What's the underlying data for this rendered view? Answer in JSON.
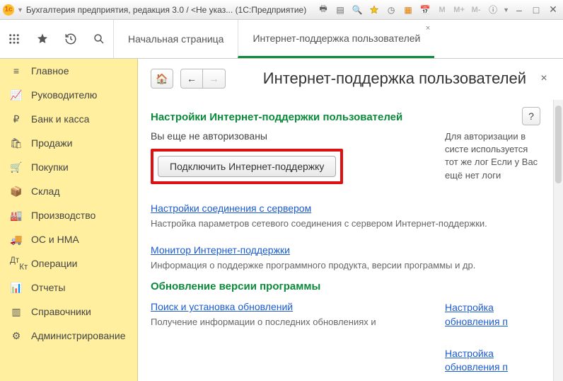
{
  "window": {
    "title": "Бухгалтерия предприятия, редакция 3.0 / <Не указ...  (1С:Предприятие)"
  },
  "toolbar": {
    "grid_icon": "grid",
    "star_icon": "star",
    "history_icon": "history",
    "search_icon": "search"
  },
  "tabs": [
    {
      "label": "Начальная страница",
      "active": false
    },
    {
      "label": "Интернет-поддержка пользователей",
      "active": true
    }
  ],
  "sidebar": {
    "items": [
      {
        "icon": "menu",
        "label": "Главное"
      },
      {
        "icon": "chart",
        "label": "Руководителю"
      },
      {
        "icon": "ruble",
        "label": "Банк и касса"
      },
      {
        "icon": "bag",
        "label": "Продажи"
      },
      {
        "icon": "cart",
        "label": "Покупки"
      },
      {
        "icon": "box",
        "label": "Склад"
      },
      {
        "icon": "factory",
        "label": "Производство"
      },
      {
        "icon": "truck",
        "label": "ОС и НМА"
      },
      {
        "icon": "ops",
        "label": "Операции"
      },
      {
        "icon": "report",
        "label": "Отчеты"
      },
      {
        "icon": "book",
        "label": "Справочники"
      },
      {
        "icon": "gear",
        "label": "Администрирование"
      }
    ]
  },
  "page": {
    "title": "Интернет-поддержка пользователей",
    "section1_title": "Настройки Интернет-поддержки пользователей",
    "not_authorized": "Вы еще не авторизованы",
    "connect_btn": "Подключить Интернет-поддержку",
    "auth_hint": "Для авторизации в систе используется тот же лог Если у Вас ещё нет логи",
    "link_conn": "Настройки соединения с сервером",
    "desc_conn": "Настройка параметров сетевого соединения с сервером Интернет-поддержки.",
    "link_monitor": "Монитор Интернет-поддержки",
    "desc_monitor": "Информация о поддержке программного продукта, версии программы и др.",
    "section2_title": "Обновление версии программы",
    "link_update_search": "Поиск и установка обновлений",
    "desc_update_search": "Получение информации о последних обновлениях и",
    "link_update_cfg": "Настройка обновления п",
    "link_update_cfg2": "Настройка обновления п",
    "help_q": "?"
  }
}
